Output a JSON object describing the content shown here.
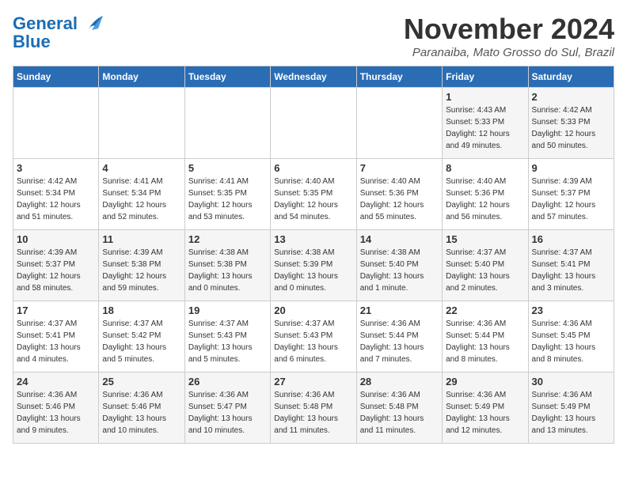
{
  "logo": {
    "line1": "General",
    "line2": "Blue"
  },
  "header": {
    "month": "November 2024",
    "location": "Paranaiba, Mato Grosso do Sul, Brazil"
  },
  "weekdays": [
    "Sunday",
    "Monday",
    "Tuesday",
    "Wednesday",
    "Thursday",
    "Friday",
    "Saturday"
  ],
  "weeks": [
    [
      {
        "day": "",
        "info": ""
      },
      {
        "day": "",
        "info": ""
      },
      {
        "day": "",
        "info": ""
      },
      {
        "day": "",
        "info": ""
      },
      {
        "day": "",
        "info": ""
      },
      {
        "day": "1",
        "info": "Sunrise: 4:43 AM\nSunset: 5:33 PM\nDaylight: 12 hours\nand 49 minutes."
      },
      {
        "day": "2",
        "info": "Sunrise: 4:42 AM\nSunset: 5:33 PM\nDaylight: 12 hours\nand 50 minutes."
      }
    ],
    [
      {
        "day": "3",
        "info": "Sunrise: 4:42 AM\nSunset: 5:34 PM\nDaylight: 12 hours\nand 51 minutes."
      },
      {
        "day": "4",
        "info": "Sunrise: 4:41 AM\nSunset: 5:34 PM\nDaylight: 12 hours\nand 52 minutes."
      },
      {
        "day": "5",
        "info": "Sunrise: 4:41 AM\nSunset: 5:35 PM\nDaylight: 12 hours\nand 53 minutes."
      },
      {
        "day": "6",
        "info": "Sunrise: 4:40 AM\nSunset: 5:35 PM\nDaylight: 12 hours\nand 54 minutes."
      },
      {
        "day": "7",
        "info": "Sunrise: 4:40 AM\nSunset: 5:36 PM\nDaylight: 12 hours\nand 55 minutes."
      },
      {
        "day": "8",
        "info": "Sunrise: 4:40 AM\nSunset: 5:36 PM\nDaylight: 12 hours\nand 56 minutes."
      },
      {
        "day": "9",
        "info": "Sunrise: 4:39 AM\nSunset: 5:37 PM\nDaylight: 12 hours\nand 57 minutes."
      }
    ],
    [
      {
        "day": "10",
        "info": "Sunrise: 4:39 AM\nSunset: 5:37 PM\nDaylight: 12 hours\nand 58 minutes."
      },
      {
        "day": "11",
        "info": "Sunrise: 4:39 AM\nSunset: 5:38 PM\nDaylight: 12 hours\nand 59 minutes."
      },
      {
        "day": "12",
        "info": "Sunrise: 4:38 AM\nSunset: 5:38 PM\nDaylight: 13 hours\nand 0 minutes."
      },
      {
        "day": "13",
        "info": "Sunrise: 4:38 AM\nSunset: 5:39 PM\nDaylight: 13 hours\nand 0 minutes."
      },
      {
        "day": "14",
        "info": "Sunrise: 4:38 AM\nSunset: 5:40 PM\nDaylight: 13 hours\nand 1 minute."
      },
      {
        "day": "15",
        "info": "Sunrise: 4:37 AM\nSunset: 5:40 PM\nDaylight: 13 hours\nand 2 minutes."
      },
      {
        "day": "16",
        "info": "Sunrise: 4:37 AM\nSunset: 5:41 PM\nDaylight: 13 hours\nand 3 minutes."
      }
    ],
    [
      {
        "day": "17",
        "info": "Sunrise: 4:37 AM\nSunset: 5:41 PM\nDaylight: 13 hours\nand 4 minutes."
      },
      {
        "day": "18",
        "info": "Sunrise: 4:37 AM\nSunset: 5:42 PM\nDaylight: 13 hours\nand 5 minutes."
      },
      {
        "day": "19",
        "info": "Sunrise: 4:37 AM\nSunset: 5:43 PM\nDaylight: 13 hours\nand 5 minutes."
      },
      {
        "day": "20",
        "info": "Sunrise: 4:37 AM\nSunset: 5:43 PM\nDaylight: 13 hours\nand 6 minutes."
      },
      {
        "day": "21",
        "info": "Sunrise: 4:36 AM\nSunset: 5:44 PM\nDaylight: 13 hours\nand 7 minutes."
      },
      {
        "day": "22",
        "info": "Sunrise: 4:36 AM\nSunset: 5:44 PM\nDaylight: 13 hours\nand 8 minutes."
      },
      {
        "day": "23",
        "info": "Sunrise: 4:36 AM\nSunset: 5:45 PM\nDaylight: 13 hours\nand 8 minutes."
      }
    ],
    [
      {
        "day": "24",
        "info": "Sunrise: 4:36 AM\nSunset: 5:46 PM\nDaylight: 13 hours\nand 9 minutes."
      },
      {
        "day": "25",
        "info": "Sunrise: 4:36 AM\nSunset: 5:46 PM\nDaylight: 13 hours\nand 10 minutes."
      },
      {
        "day": "26",
        "info": "Sunrise: 4:36 AM\nSunset: 5:47 PM\nDaylight: 13 hours\nand 10 minutes."
      },
      {
        "day": "27",
        "info": "Sunrise: 4:36 AM\nSunset: 5:48 PM\nDaylight: 13 hours\nand 11 minutes."
      },
      {
        "day": "28",
        "info": "Sunrise: 4:36 AM\nSunset: 5:48 PM\nDaylight: 13 hours\nand 11 minutes."
      },
      {
        "day": "29",
        "info": "Sunrise: 4:36 AM\nSunset: 5:49 PM\nDaylight: 13 hours\nand 12 minutes."
      },
      {
        "day": "30",
        "info": "Sunrise: 4:36 AM\nSunset: 5:49 PM\nDaylight: 13 hours\nand 13 minutes."
      }
    ]
  ]
}
